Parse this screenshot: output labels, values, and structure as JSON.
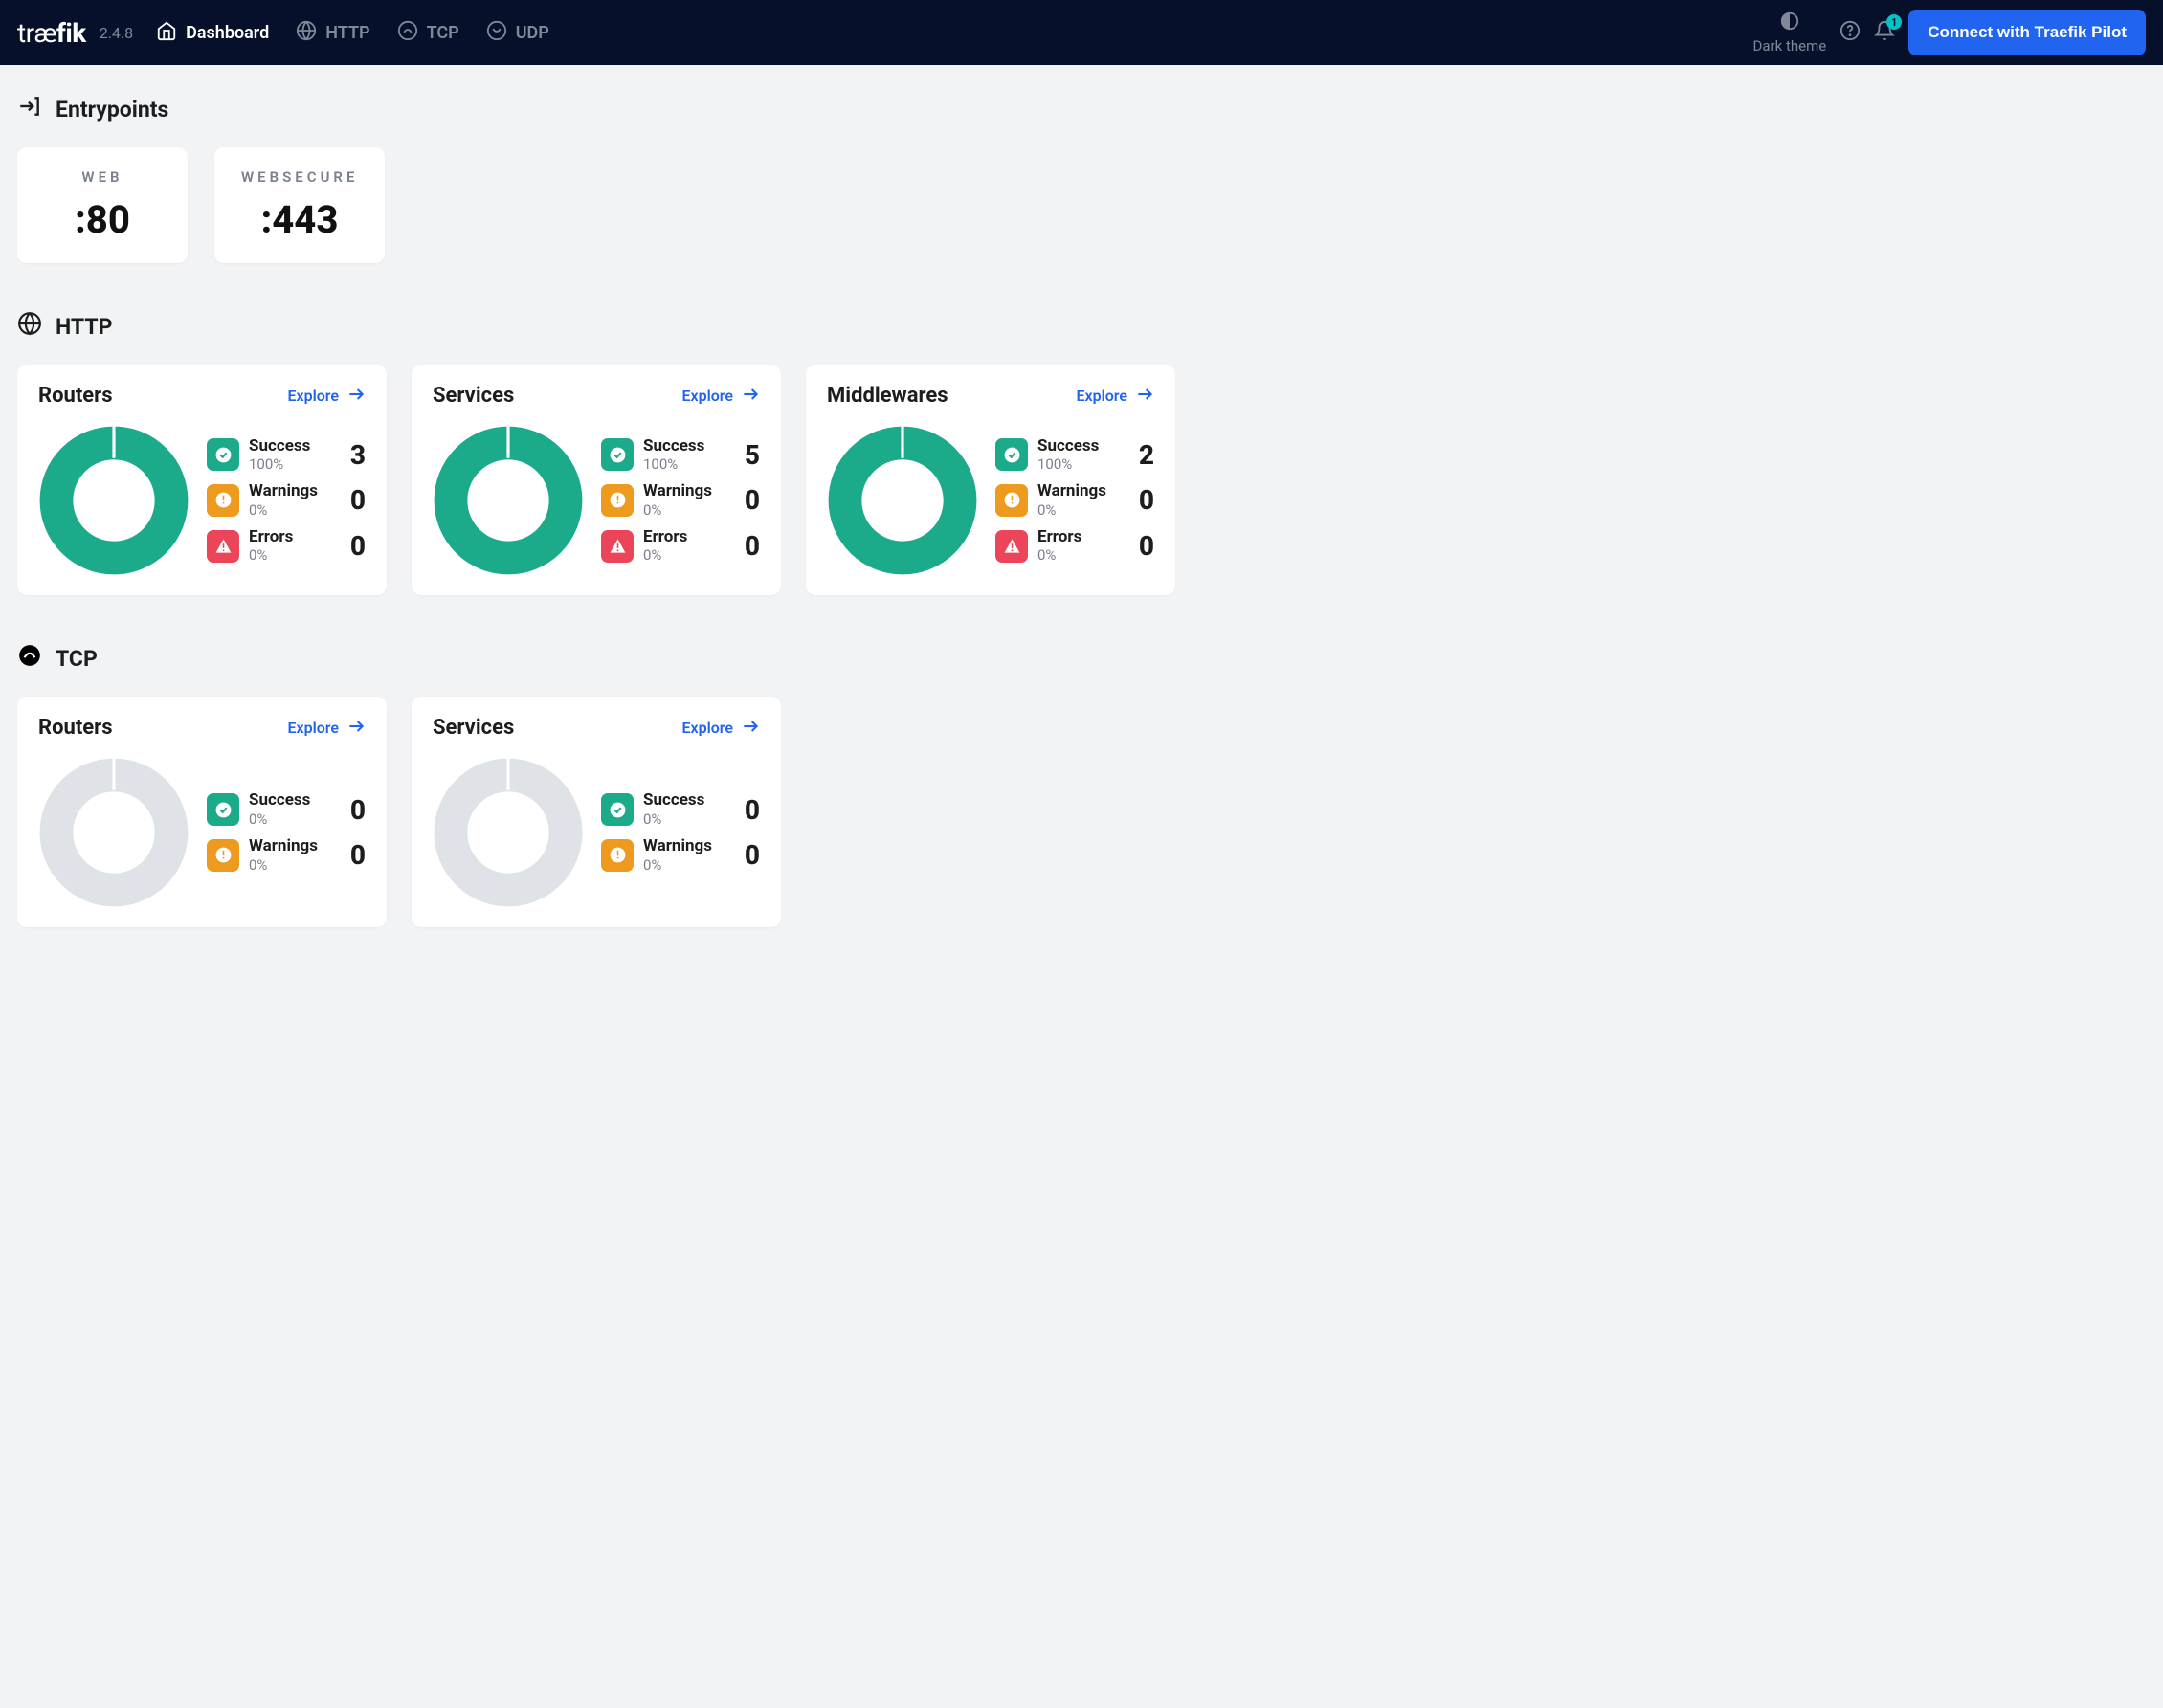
{
  "app": {
    "name": "traefik",
    "version": "2.4.8"
  },
  "nav": {
    "dashboard": "Dashboard",
    "http": "HTTP",
    "tcp": "TCP",
    "udp": "UDP"
  },
  "header": {
    "dark_theme": "Dark theme",
    "pilot_button": "Connect with Traefik Pilot",
    "notification_count": "1"
  },
  "sections": {
    "entrypoints": {
      "title": "Entrypoints",
      "items": [
        {
          "name": "WEB",
          "port": ":80"
        },
        {
          "name": "WEBSECURE",
          "port": ":443"
        }
      ]
    },
    "http": {
      "title": "HTTP",
      "cards": [
        {
          "title": "Routers",
          "explore": "Explore",
          "success_pct": "100%",
          "warning_pct": "0%",
          "error_pct": "0%",
          "success": "3",
          "warnings": "0",
          "errors": "0",
          "donut_color": "#1bab8b"
        },
        {
          "title": "Services",
          "explore": "Explore",
          "success_pct": "100%",
          "warning_pct": "0%",
          "error_pct": "0%",
          "success": "5",
          "warnings": "0",
          "errors": "0",
          "donut_color": "#1bab8b"
        },
        {
          "title": "Middlewares",
          "explore": "Explore",
          "success_pct": "100%",
          "warning_pct": "0%",
          "error_pct": "0%",
          "success": "2",
          "warnings": "0",
          "errors": "0",
          "donut_color": "#1bab8b"
        }
      ]
    },
    "tcp": {
      "title": "TCP",
      "cards": [
        {
          "title": "Routers",
          "explore": "Explore",
          "success_pct": "0%",
          "warning_pct": "0%",
          "success": "0",
          "warnings": "0",
          "donut_color": "#dfe2e7"
        },
        {
          "title": "Services",
          "explore": "Explore",
          "success_pct": "0%",
          "warning_pct": "0%",
          "success": "0",
          "warnings": "0",
          "donut_color": "#dfe2e7"
        }
      ]
    }
  },
  "labels": {
    "success": "Success",
    "warnings": "Warnings",
    "errors": "Errors"
  },
  "chart_data": {
    "type": "pie",
    "title": "Traefik Dashboard status donuts",
    "series": [
      {
        "name": "HTTP Routers",
        "categories": [
          "Success",
          "Warnings",
          "Errors"
        ],
        "values": [
          3,
          0,
          0
        ],
        "percent": [
          100,
          0,
          0
        ]
      },
      {
        "name": "HTTP Services",
        "categories": [
          "Success",
          "Warnings",
          "Errors"
        ],
        "values": [
          5,
          0,
          0
        ],
        "percent": [
          100,
          0,
          0
        ]
      },
      {
        "name": "HTTP Middlewares",
        "categories": [
          "Success",
          "Warnings",
          "Errors"
        ],
        "values": [
          2,
          0,
          0
        ],
        "percent": [
          100,
          0,
          0
        ]
      },
      {
        "name": "TCP Routers",
        "categories": [
          "Success",
          "Warnings",
          "Errors"
        ],
        "values": [
          0,
          0,
          0
        ],
        "percent": [
          0,
          0,
          0
        ]
      },
      {
        "name": "TCP Services",
        "categories": [
          "Success",
          "Warnings",
          "Errors"
        ],
        "values": [
          0,
          0,
          0
        ],
        "percent": [
          0,
          0,
          0
        ]
      }
    ]
  }
}
